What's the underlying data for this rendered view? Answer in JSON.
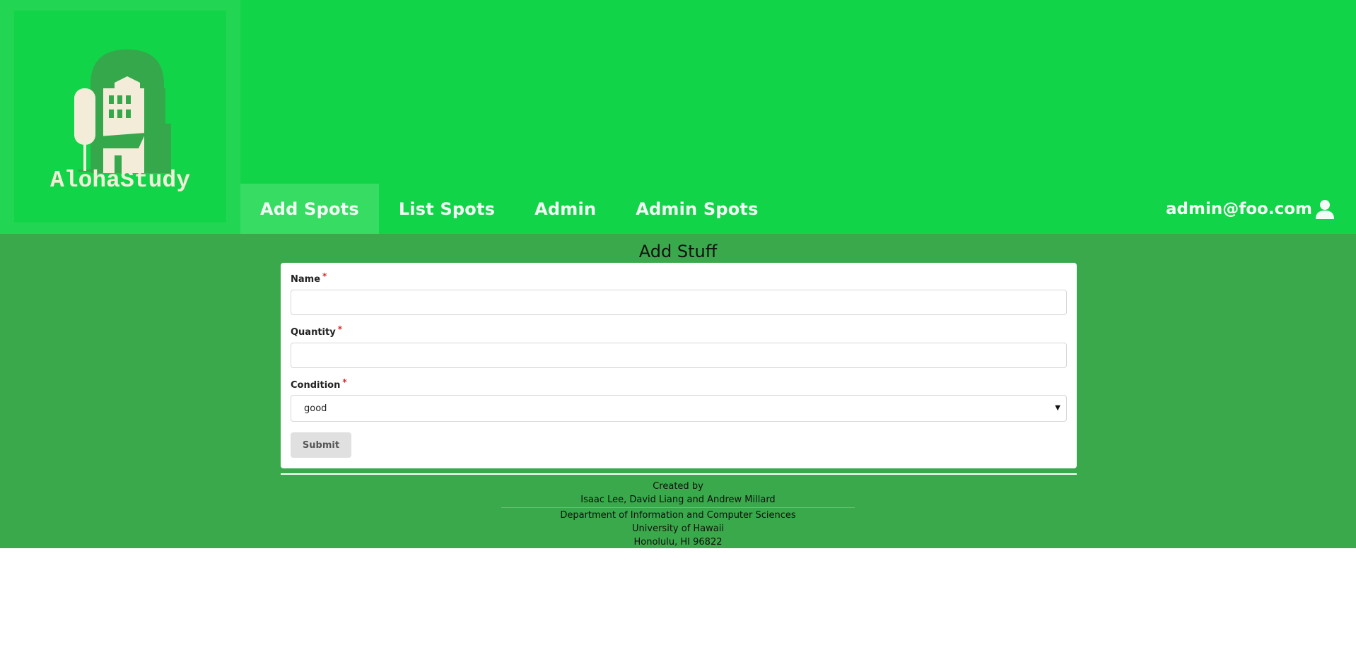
{
  "brand": {
    "name": "AlohaStudy",
    "logo_icon": "building-tree-logo"
  },
  "colors": {
    "header_bg": "#12d448",
    "nav_active_bg": "#37dc63",
    "main_bg": "#3aa94b",
    "logo_text": "#f2ecd8",
    "required": "#db2828"
  },
  "nav": {
    "items": [
      {
        "label": "Add Spots",
        "active": true
      },
      {
        "label": "List Spots",
        "active": false
      },
      {
        "label": "Admin",
        "active": false
      },
      {
        "label": "Admin Spots",
        "active": false
      }
    ],
    "user": {
      "email": "admin@foo.com",
      "icon": "user-icon"
    }
  },
  "page": {
    "title": "Add Stuff"
  },
  "form": {
    "name_label": "Name",
    "name_value": "",
    "quantity_label": "Quantity",
    "quantity_value": "",
    "condition_label": "Condition",
    "condition_value": "good",
    "required_marker": "*",
    "submit_label": "Submit"
  },
  "footer": {
    "created_by": "Created by",
    "authors": "Isaac Lee, David Liang and Andrew Millard",
    "department": "Department of Information and Computer Sciences",
    "university": "University of Hawaii",
    "address": "Honolulu, HI 96822"
  }
}
